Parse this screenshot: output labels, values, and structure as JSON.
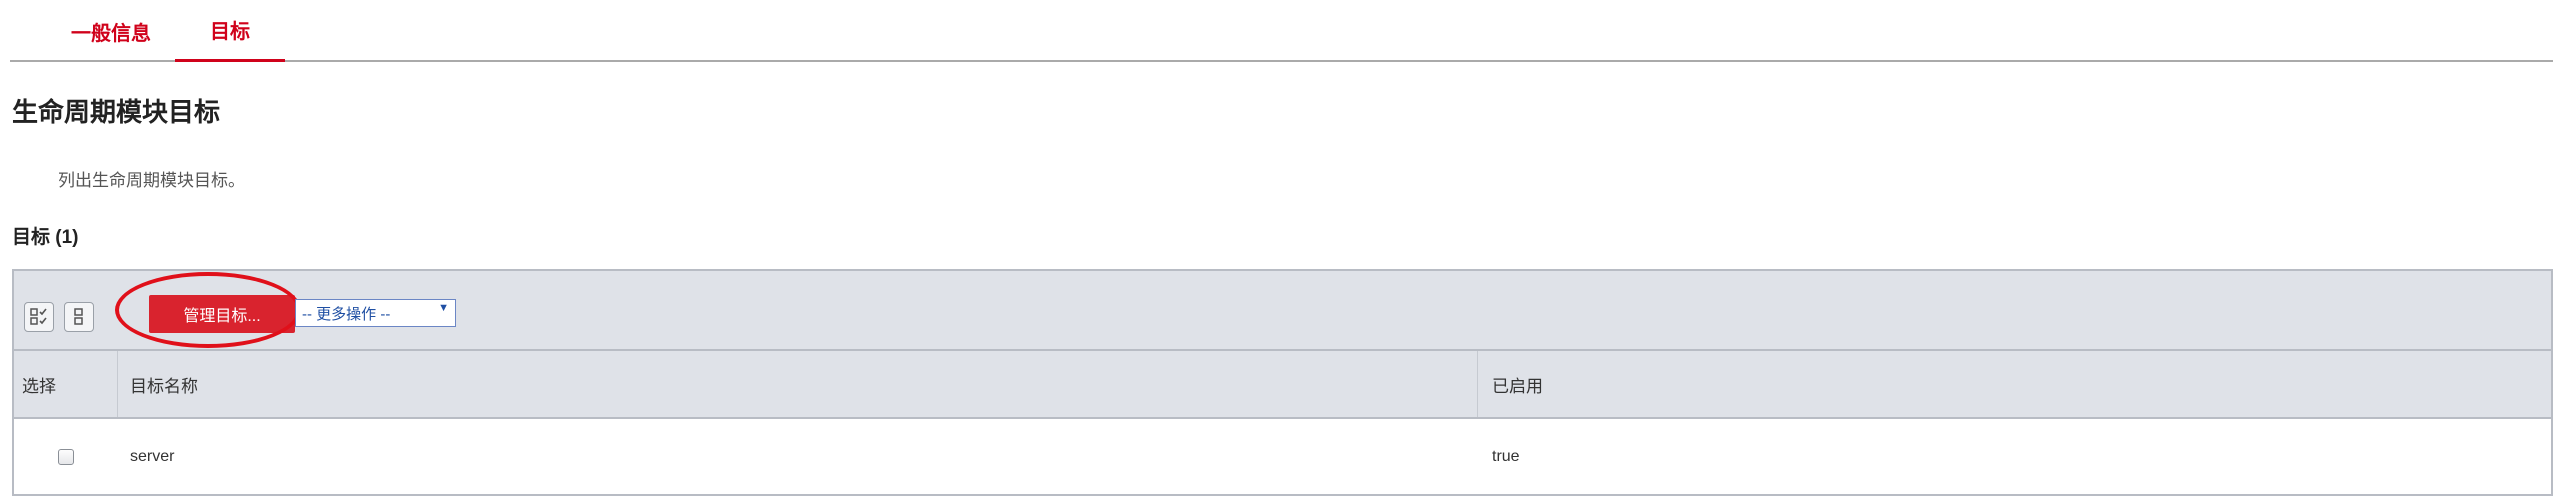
{
  "tabs": [
    {
      "label": "一般信息"
    },
    {
      "label": "目标"
    }
  ],
  "page": {
    "title": "生命周期模块目标",
    "description": "列出生命周期模块目标。",
    "section_title": "目标 (1)"
  },
  "toolbar": {
    "manage_label": "管理目标...",
    "more_actions_label": "-- 更多操作 --",
    "more_actions_arrow": "▼"
  },
  "table": {
    "columns": [
      "选择",
      "目标名称",
      "已启用"
    ],
    "rows": [
      {
        "name": "server",
        "enabled": "true"
      }
    ]
  },
  "colors": {
    "accent": "#d0021b",
    "button": "#d9232e",
    "toolbar_bg": "#dfe2e8",
    "link_blue": "#1f4fa3"
  },
  "icons": {
    "select_all": "select-all-icon",
    "column_toggle": "column-toggle-icon"
  }
}
